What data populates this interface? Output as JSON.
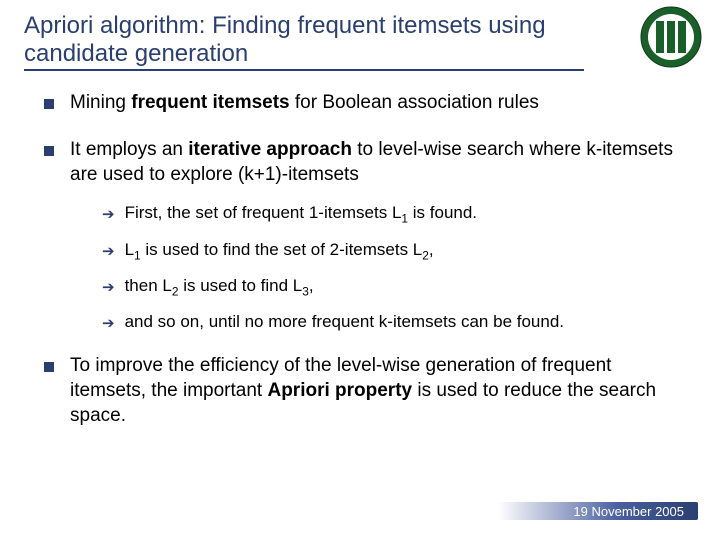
{
  "title": "Apriori algorithm: Finding frequent itemsets using candidate generation",
  "bullets": [
    {
      "html": "Mining <b>frequent itemsets</b> for Boolean association rules"
    },
    {
      "html": "It employs an <b>iterative approach</b> to level-wise search where k-itemsets are used to explore (k+1)-itemsets"
    }
  ],
  "subbullets": [
    {
      "html": "First, the set of frequent 1-itemsets L<sub>1</sub> is found."
    },
    {
      "html": "L<sub>1</sub> is used to find the set of 2-itemsets L<sub>2</sub>,"
    },
    {
      "html": "then L<sub>2</sub> is used to find L<sub>3</sub>,"
    },
    {
      "html": "and so on, until no more frequent k-itemsets can be found."
    }
  ],
  "bullet3": {
    "html": "To improve the efficiency of the level-wise generation of frequent itemsets, the important <b>Apriori property</b> is used to reduce the search space."
  },
  "footer_date": "19 November 2005"
}
